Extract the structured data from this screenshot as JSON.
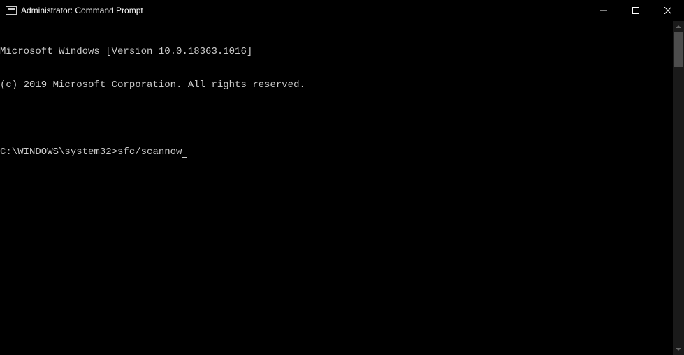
{
  "window": {
    "title": "Administrator: Command Prompt"
  },
  "terminal": {
    "line1": "Microsoft Windows [Version 10.0.18363.1016]",
    "line2": "(c) 2019 Microsoft Corporation. All rights reserved.",
    "prompt": "C:\\WINDOWS\\system32>",
    "command": "sfc/scannow"
  }
}
